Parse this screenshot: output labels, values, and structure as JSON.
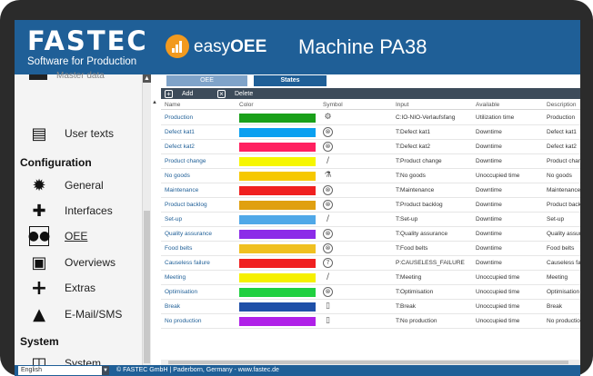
{
  "header": {
    "brand": "FASTEC",
    "brand_sub": "Software for Production",
    "product_easy": "easy",
    "product_oee": "OEE",
    "title": "Machine PA38",
    "colors": {
      "header_bg": "#1f5f97",
      "oee_logo": "#f29a1f"
    }
  },
  "sidebar": {
    "partial_item": "Master data",
    "items_top": [
      {
        "label": "User texts",
        "icon": "document-icon"
      }
    ],
    "section_configuration": "Configuration",
    "items_config": [
      {
        "label": "General",
        "icon": "gear-icon"
      },
      {
        "label": "Interfaces",
        "icon": "plug-icon"
      },
      {
        "label": "OEE",
        "icon": "oee-icon"
      },
      {
        "label": "Overviews",
        "icon": "overview-icon"
      },
      {
        "label": "Extras",
        "icon": "plus-icon"
      },
      {
        "label": "E-Mail/SMS",
        "icon": "warning-icon"
      }
    ],
    "section_system": "System",
    "items_system": [
      {
        "label": "System",
        "icon": "system-icon"
      }
    ]
  },
  "tabs": {
    "oee": "OEE",
    "states": "States"
  },
  "toolbar": {
    "add": "Add",
    "delete": "Delete"
  },
  "table": {
    "columns": [
      "Name",
      "Color",
      "Symbol",
      "Input",
      "Available",
      "Description"
    ],
    "rows": [
      {
        "name": "Production",
        "color": "#1aa01a",
        "symbol": "gears-icon",
        "input": "C:IO-NIO-Verlaufsfang",
        "available": "Utilization time",
        "description": "Production"
      },
      {
        "name": "Defect kat1",
        "color": "#0aa0f0",
        "symbol": "x-circle-icon",
        "input": "T:Defect kat1",
        "available": "Downtime",
        "description": "Defect kat1"
      },
      {
        "name": "Defect kat2",
        "color": "#ff2060",
        "symbol": "x-circle-icon",
        "input": "T:Defect kat2",
        "available": "Downtime",
        "description": "Defect kat2"
      },
      {
        "name": "Product change",
        "color": "#f6f600",
        "symbol": "wrench-icon",
        "input": "T:Product change",
        "available": "Downtime",
        "description": "Product change"
      },
      {
        "name": "No goods",
        "color": "#f6c800",
        "symbol": "flask-icon",
        "input": "T:No goods",
        "available": "Unoccupied time",
        "description": "No goods"
      },
      {
        "name": "Maintenance",
        "color": "#f02020",
        "symbol": "x-circle-icon",
        "input": "T:Maintenance",
        "available": "Downtime",
        "description": "Maintenance"
      },
      {
        "name": "Product backlog",
        "color": "#e0a010",
        "symbol": "x-circle-icon",
        "input": "T:Product backlog",
        "available": "Downtime",
        "description": "Product backlog"
      },
      {
        "name": "Set-up",
        "color": "#50a8e8",
        "symbol": "wrench-icon",
        "input": "T:Set-up",
        "available": "Downtime",
        "description": "Set-up"
      },
      {
        "name": "Quality assurance",
        "color": "#8c2ce8",
        "symbol": "x-circle-icon",
        "input": "T:Quality assurance",
        "available": "Downtime",
        "description": "Quality assurance"
      },
      {
        "name": "Food belts",
        "color": "#f0c020",
        "symbol": "x-circle-icon",
        "input": "T:Food belts",
        "available": "Downtime",
        "description": "Food belts"
      },
      {
        "name": "Causeless failure",
        "color": "#f02020",
        "symbol": "question-icon",
        "input": "P:CAUSELESS_FAILURE",
        "available": "Downtime",
        "description": "Causeless failure"
      },
      {
        "name": "Meeting",
        "color": "#f6f000",
        "symbol": "wrench-icon",
        "input": "T:Meeting",
        "available": "Unoccupied time",
        "description": "Meeting"
      },
      {
        "name": "Optimisation",
        "color": "#20d040",
        "symbol": "x-circle-icon",
        "input": "T:Optimisation",
        "available": "Unoccupied time",
        "description": "Optimisation"
      },
      {
        "name": "Break",
        "color": "#1f50a8",
        "symbol": "trash-icon",
        "input": "T:Break",
        "available": "Unoccupied time",
        "description": "Break"
      },
      {
        "name": "No production",
        "color": "#b020e8",
        "symbol": "trash-icon",
        "input": "T:No production",
        "available": "Unoccupied time",
        "description": "No production"
      }
    ]
  },
  "footer": {
    "language": "English",
    "copyright": "© FASTEC GmbH | Paderborn, Germany - www.fastec.de"
  }
}
